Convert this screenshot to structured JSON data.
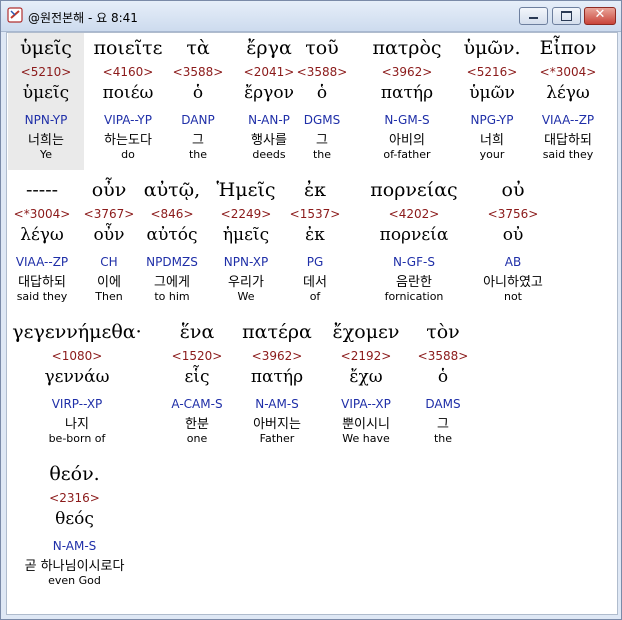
{
  "window": {
    "title": "@원전본해 - 요 8:41"
  },
  "words": [
    {
      "greek": "ὑμεῖς",
      "strong": "<5210>",
      "lemma": "ὑμεῖς",
      "parse": "NPN-YP",
      "korean": "너희는",
      "english": "Ye"
    },
    {
      "greek": "ποιεῖτε",
      "strong": "<4160>",
      "lemma": "ποιέω",
      "parse": "VIPA--YP",
      "korean": "하는도다",
      "english": "do"
    },
    {
      "greek": "τὰ",
      "strong": "<3588>",
      "lemma": "ὁ",
      "parse": "DANP",
      "korean": "그",
      "english": "the"
    },
    {
      "greek": "ἔργα",
      "strong": "<2041>",
      "lemma": "ἔργον",
      "parse": "N-AN-P",
      "korean": "행사를",
      "english": "deeds"
    },
    {
      "greek": "τοῦ",
      "strong": "<3588>",
      "lemma": "ὁ",
      "parse": "DGMS",
      "korean": "그",
      "english": "the"
    },
    {
      "greek": "πατρὸς",
      "strong": "<3962>",
      "lemma": "πατήρ",
      "parse": "N-GM-S",
      "korean": "아비의",
      "english": "of-father"
    },
    {
      "greek": "ὑμῶν.",
      "strong": "<5216>",
      "lemma": "ὑμῶν",
      "parse": "NPG-YP",
      "korean": "너희",
      "english": "your"
    },
    {
      "greek": "Εἶπον",
      "strong": "<*3004>",
      "lemma": "λέγω",
      "parse": "VIAA--ZP",
      "korean": "대답하되",
      "english": "said they"
    },
    {
      "greek": "-----",
      "strong": "<*3004>",
      "lemma": "λέγω",
      "parse": "VIAA--ZP",
      "korean": "대답하되",
      "english": "said they"
    },
    {
      "greek": "οὖν",
      "strong": "<3767>",
      "lemma": "οὖν",
      "parse": "CH",
      "korean": "이에",
      "english": "Then"
    },
    {
      "greek": "αὐτῷ,",
      "strong": "<846>",
      "lemma": "αὐτός",
      "parse": "NPDMZS",
      "korean": "그에게",
      "english": "to him"
    },
    {
      "greek": "Ἡμεῖς",
      "strong": "<2249>",
      "lemma": "ἡμεῖς",
      "parse": "NPN-XP",
      "korean": "우리가",
      "english": "We"
    },
    {
      "greek": "ἐκ",
      "strong": "<1537>",
      "lemma": "ἐκ",
      "parse": "PG",
      "korean": "데서",
      "english": "of"
    },
    {
      "greek": "πορνείας",
      "strong": "<4202>",
      "lemma": "πορνεία",
      "parse": "N-GF-S",
      "korean": "음란한",
      "english": "fornication"
    },
    {
      "greek": "οὐ",
      "strong": "<3756>",
      "lemma": "οὐ",
      "parse": "AB",
      "korean": "아니하였고",
      "english": "not"
    },
    {
      "greek": "γεγεννήμεθα·",
      "strong": "<1080>",
      "lemma": "γεννάω",
      "parse": "VIRP--XP",
      "korean": "나지",
      "english": "be-born of"
    },
    {
      "greek": "ἕνα",
      "strong": "<1520>",
      "lemma": "εἷς",
      "parse": "A-CAM-S",
      "korean": "한분",
      "english": "one"
    },
    {
      "greek": "πατέρα",
      "strong": "<3962>",
      "lemma": "πατήρ",
      "parse": "N-AM-S",
      "korean": "아버지는",
      "english": "Father"
    },
    {
      "greek": "ἔχομεν",
      "strong": "<2192>",
      "lemma": "ἔχω",
      "parse": "VIPA--XP",
      "korean": "뿐이시니",
      "english": "We have"
    },
    {
      "greek": "τὸν",
      "strong": "<3588>",
      "lemma": "ὁ",
      "parse": "DAMS",
      "korean": "그",
      "english": "the"
    },
    {
      "greek": "θεόν.",
      "strong": "<2316>",
      "lemma": "θεός",
      "parse": "N-AM-S",
      "korean": "곧 하나님이시로다",
      "english": "even God"
    }
  ]
}
